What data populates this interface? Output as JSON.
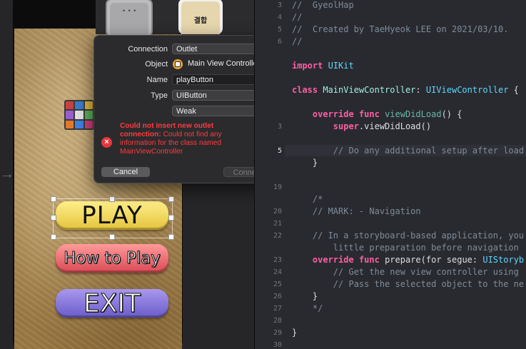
{
  "connection_popover": {
    "connection_label": "Connection",
    "connection_value": "Outlet",
    "object_label": "Object",
    "object_value": "Main View Controller",
    "name_label": "Name",
    "name_value": "playButton",
    "type_label": "Type",
    "type_value": "UIButton",
    "storage_value": "Weak",
    "error_title": "Could not insert new outlet connection:",
    "error_message": " Could not find any information for the class named MainViewController",
    "cancel_label": "Cancel",
    "connect_label": "Connect"
  },
  "storyboard": {
    "play_label": "PLAY",
    "howto_label": "How to Play",
    "exit_label": "EXIT",
    "thumb_b_label": "결합",
    "thumb_a_label": "• • •"
  },
  "editor": {
    "lines": [
      {
        "num": "3",
        "text": "//  GyeolHap"
      },
      {
        "num": "4",
        "text": "//"
      },
      {
        "num": "5",
        "text": "//  Created by TaeHyeok LEE on 2021/03/10."
      },
      {
        "num": "6",
        "text": "//"
      },
      {
        "num": "",
        "text": ""
      },
      {
        "num": "",
        "text": "import UIKit"
      },
      {
        "num": "",
        "text": ""
      },
      {
        "num": "",
        "text": "class MainViewController: UIViewController {"
      },
      {
        "num": "",
        "text": ""
      },
      {
        "num": "",
        "text": "    override func viewDidLoad() {"
      },
      {
        "num": "3",
        "text": "        super.viewDidLoad()"
      },
      {
        "num": "",
        "text": ""
      },
      {
        "num": "5",
        "text": "        // Do any additional setup after load"
      },
      {
        "num": "",
        "text": "    }"
      },
      {
        "num": "",
        "text": ""
      },
      {
        "num": "19",
        "text": ""
      },
      {
        "num": "",
        "text": "    /*"
      },
      {
        "num": "20",
        "text": "    // MARK: - Navigation"
      },
      {
        "num": "21",
        "text": ""
      },
      {
        "num": "22",
        "text": "    // In a storyboard-based application, you"
      },
      {
        "num": "",
        "text": "        little preparation before navigation"
      },
      {
        "num": "23",
        "text": "    override func prepare(for segue: UIStoryb"
      },
      {
        "num": "24",
        "text": "        // Get the new view controller using"
      },
      {
        "num": "25",
        "text": "        // Pass the selected object to the ne"
      },
      {
        "num": "26",
        "text": "    }"
      },
      {
        "num": "27",
        "text": "    */"
      },
      {
        "num": "28",
        "text": ""
      },
      {
        "num": "29",
        "text": "}"
      },
      {
        "num": "30",
        "text": ""
      }
    ]
  },
  "colors": {
    "error_red": "#ff3b3f",
    "keyword_pink": "#fc5fa3",
    "type_cyan": "#5dd8ff",
    "comment_gray": "#7f8c98",
    "editor_bg": "#292a30"
  }
}
